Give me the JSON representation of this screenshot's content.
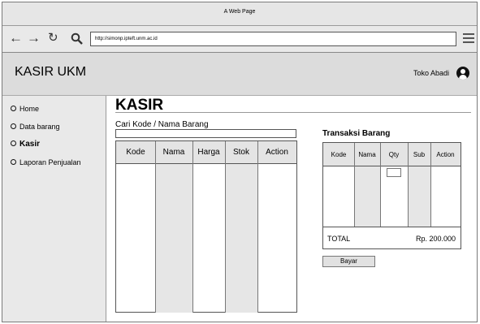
{
  "browser": {
    "window_title": "A Web Page",
    "url": "http://simonp.ipteft.unm.ac.id"
  },
  "header": {
    "app_title": "KASIR UKM",
    "user_name": "Toko Abadi"
  },
  "sidebar": {
    "items": [
      {
        "label": "Home"
      },
      {
        "label": "Data barang"
      },
      {
        "label": "Kasir"
      },
      {
        "label": "Laporan Penjualan"
      }
    ]
  },
  "main": {
    "page_title": "KASIR",
    "search_label": "Cari Kode / Nama Barang",
    "search_value": "",
    "items_table": {
      "columns": [
        "Kode",
        "Nama",
        "Harga",
        "Stok",
        "Action"
      ]
    },
    "transaction": {
      "title": "Transaksi Barang",
      "columns": [
        "Kode",
        "Nama",
        "Qty",
        "Sub",
        "Action"
      ],
      "qty_value": "",
      "total_label": "TOTAL",
      "total_value": "Rp. 200.000"
    },
    "pay_button_label": "Bayar"
  }
}
